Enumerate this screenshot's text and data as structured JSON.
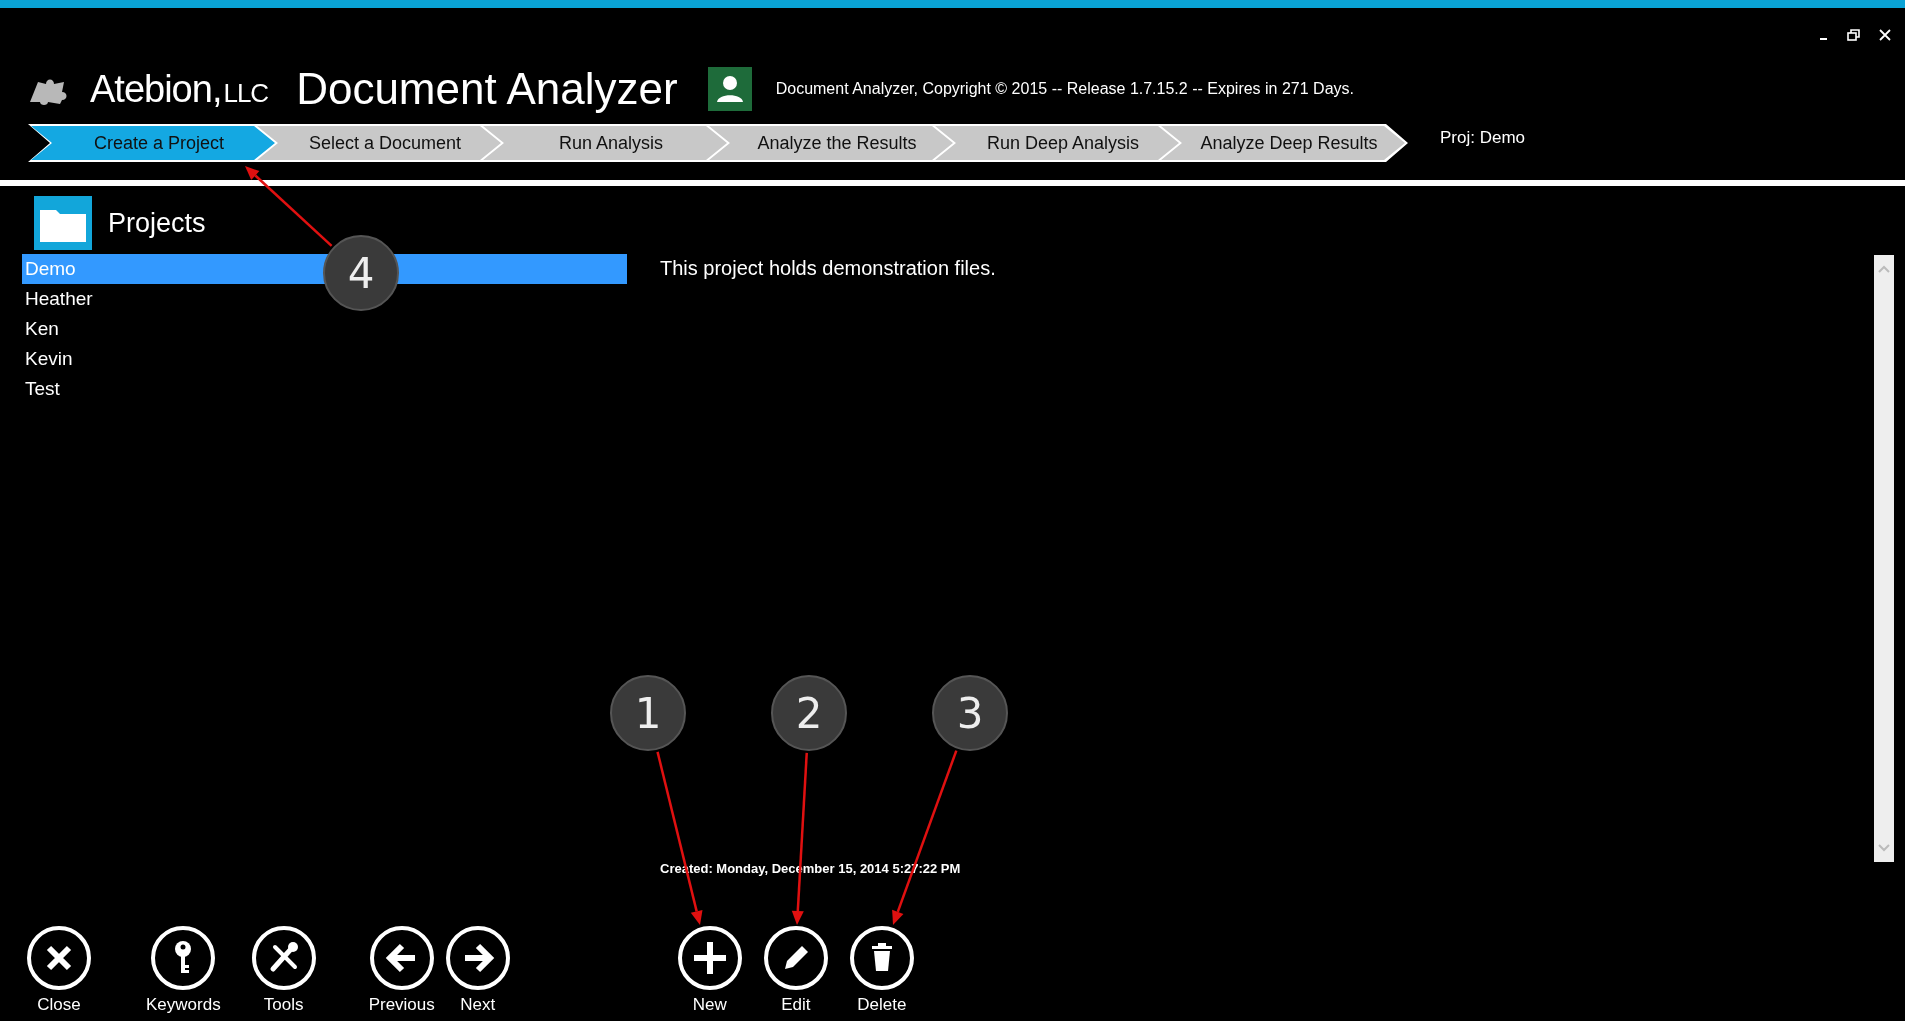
{
  "brand": {
    "company": "Atebion,",
    "suffix": "LLC",
    "app_title": "Document Analyzer",
    "copyright": "Document Analyzer, Copyright © 2015 -- Release 1.7.15.2 -- Expires in 271 Days."
  },
  "steps": [
    {
      "label": "Create a Project",
      "selected": true
    },
    {
      "label": "Select a Document",
      "selected": false
    },
    {
      "label": "Run Analysis",
      "selected": false
    },
    {
      "label": "Analyze the Results",
      "selected": false
    },
    {
      "label": "Run Deep Analysis",
      "selected": false
    },
    {
      "label": "Analyze Deep Results",
      "selected": false
    }
  ],
  "current_project": "Proj: Demo",
  "projects": {
    "title": "Projects",
    "items": [
      {
        "label": "Demo",
        "selected": true
      },
      {
        "label": "Heather",
        "selected": false
      },
      {
        "label": "Ken",
        "selected": false
      },
      {
        "label": "Kevin",
        "selected": false
      },
      {
        "label": "Test",
        "selected": false
      }
    ],
    "description": "This project holds demonstration files.",
    "created": "Created: Monday, December 15, 2014 5:27:22 PM"
  },
  "toolbar": [
    {
      "label": "Close",
      "kind": "close"
    },
    {
      "label": "Keywords",
      "kind": "key"
    },
    {
      "label": "Tools",
      "kind": "tools"
    },
    {
      "label": "Previous",
      "kind": "previous"
    },
    {
      "label": "Next",
      "kind": "next"
    },
    {
      "label": "New",
      "kind": "new"
    },
    {
      "label": "Edit",
      "kind": "edit"
    },
    {
      "label": "Delete",
      "kind": "delete"
    }
  ],
  "callouts": [
    {
      "number": "1"
    },
    {
      "number": "2"
    },
    {
      "number": "3"
    },
    {
      "number": "4"
    }
  ]
}
